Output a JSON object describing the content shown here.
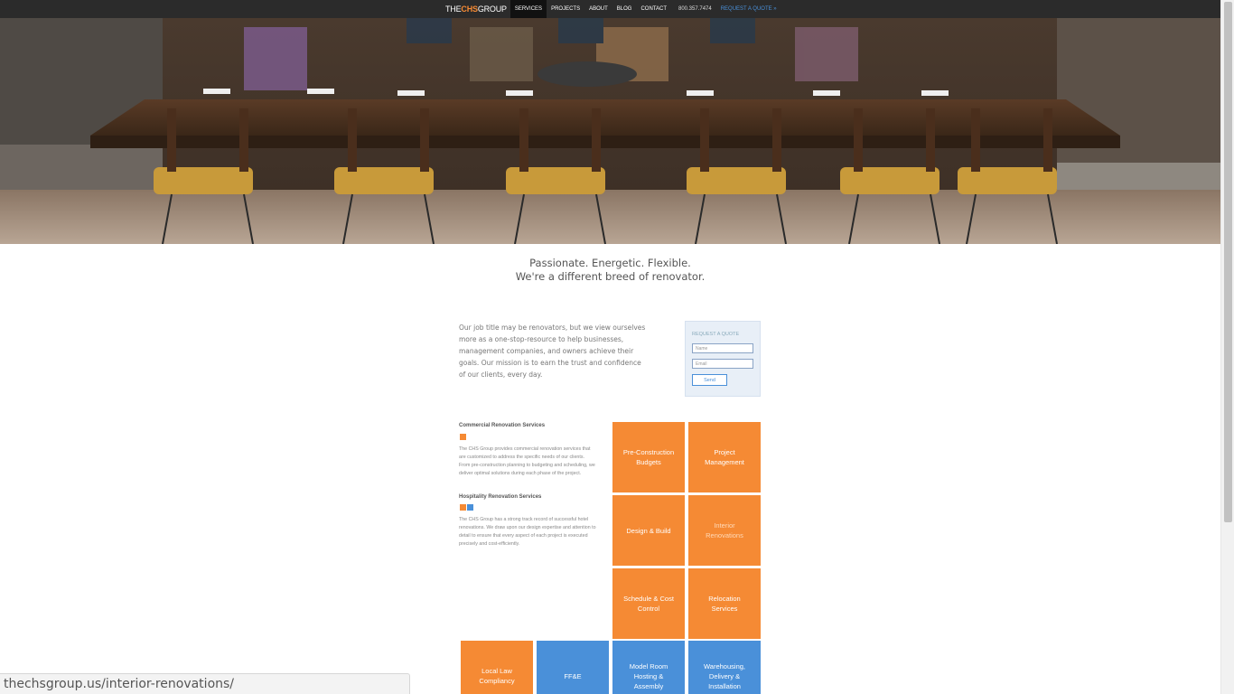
{
  "nav": {
    "logo_pre": "THE",
    "logo_accent": "CHS",
    "logo_post": "GROUP",
    "links": [
      "SERVICES",
      "PROJECTS",
      "ABOUT",
      "BLOG",
      "CONTACT"
    ],
    "phone": "800.357.7474",
    "quote": "REQUEST A QUOTE »"
  },
  "tagline": {
    "line1": "Passionate. Energetic. Flexible.",
    "line2": "We're a different breed of renovator."
  },
  "intro": {
    "text": "Our job title may be renovators, but we view ourselves more as a one-stop-resource to help businesses, management companies, and owners achieve their goals. Our mission is to earn the trust and confidence of our clients, every day."
  },
  "quote_form": {
    "title": "REQUEST A QUOTE",
    "name_placeholder": "Name",
    "email_placeholder": "Email",
    "send_label": "Send"
  },
  "services": {
    "commercial": {
      "heading": "Commercial Renovation Services",
      "desc": "The CHS Group provides commercial renovation services that are customized to address the specific needs of our clients. From pre-construction planning to budgeting and scheduling, we deliver optimal solutions during each phase of the project."
    },
    "hospitality": {
      "heading": "Hospitality Renovation Services",
      "desc": "The CHS Group has a strong track record of successful hotel renovations. We draw upon our design expertise and attention to detail to ensure that every aspect of each project is executed precisely and cost-efficiently."
    }
  },
  "tiles": {
    "preconstruction": "Pre-Construction Budgets",
    "project_management": "Project Management",
    "design_build": "Design & Build",
    "interior": "Interior Renovations",
    "schedule": "Schedule & Cost Control",
    "relocation": "Relocation Services",
    "local_law": "Local Law Compliancy",
    "ffe": "FF&E",
    "model_room": "Model Room Hosting & Assembly",
    "warehousing": "Warehousing, Delivery & Installation"
  },
  "status_url": "thechsgroup.us/interior-renovations/",
  "colors": {
    "accent_orange": "#f58a34",
    "accent_blue": "#4a90d9",
    "nav_bg": "#2b2b2b"
  }
}
